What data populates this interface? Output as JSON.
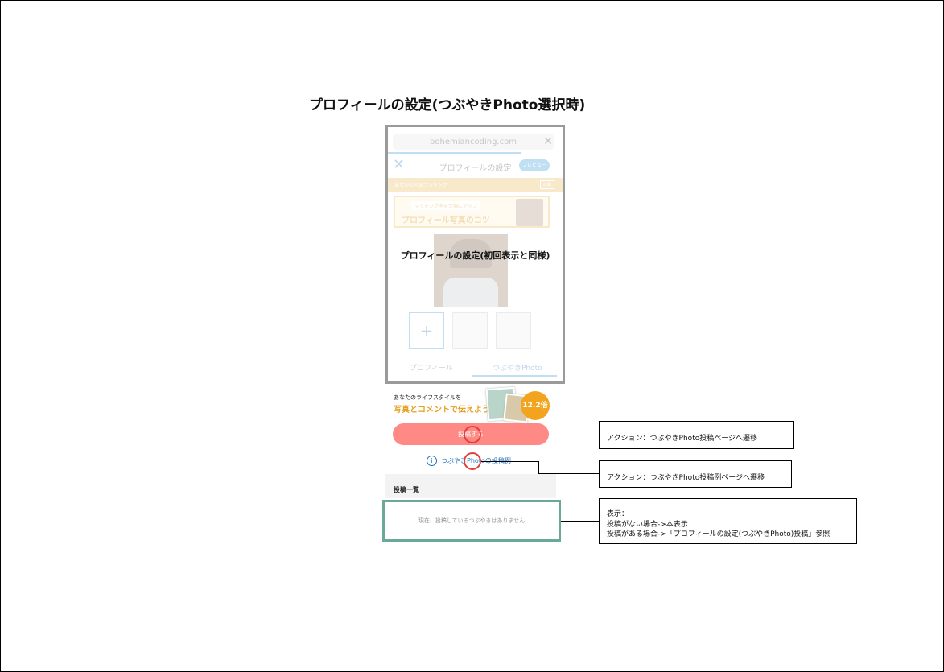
{
  "page_title": "プロフィールの設定(つぶやきPhoto選択時)",
  "phone": {
    "url": "bohemiancoding.com",
    "nav_title": "プロフィールの設定",
    "preview_label": "プレビュー",
    "banner_text": "あなたの人気ランキング",
    "banner_button": "詳細",
    "promo_sub": "マッチング率を大幅にアップ",
    "promo_main": "プロフィール写真のコツ",
    "add_tile": "+",
    "tab_profile": "プロフィール",
    "tab_tsubuyaki": "つぶやきPhoto",
    "overlay_label": "プロフィールの設定(初回表示と同様)"
  },
  "lifestyle": {
    "line1": "あなたのライフスタイルを",
    "line2": "写真とコメントで伝えよう",
    "badge": "12.2倍"
  },
  "post_button": "投稿する",
  "example_link": "つぶやきPhotoの投稿例",
  "info_icon": "i",
  "list_header": "投稿一覧",
  "empty_message": "現在、投稿しているつぶやきはありません",
  "notes": {
    "note1": "アクション：つぶやきPhoto投稿ページへ遷移",
    "note2": "アクション：つぶやきPhoto投稿例ページへ遷移",
    "note3_line1": "表示：",
    "note3_line2": "投稿がない場合->本表示",
    "note3_line3": "投稿がある場合->「プロフィールの設定(つぶやきPhoto)投稿」参照"
  },
  "colors": {
    "accent": "#1f8fd6",
    "post_button": "#ff8a85",
    "highlight_circle": "#e23c3c",
    "empty_border": "#6aa89a",
    "promo": "#e5b341"
  }
}
